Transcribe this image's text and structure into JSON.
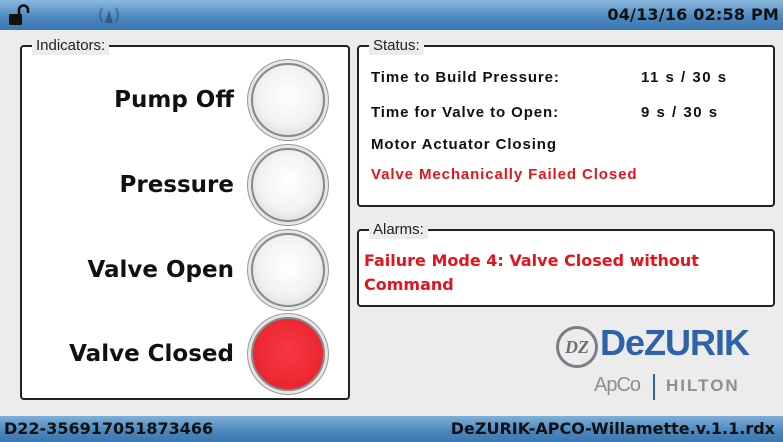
{
  "header": {
    "datetime": "04/13/16 02:58 PM",
    "lock_icon": "unlocked-padlock-icon",
    "signal_icon": "wireless-signal-icon"
  },
  "indicators": {
    "title": "Indicators:",
    "items": [
      {
        "label": "Pump Off",
        "state": "off",
        "color": "#f0f0f0"
      },
      {
        "label": "Pressure",
        "state": "off",
        "color": "#f0f0f0"
      },
      {
        "label": "Valve Open",
        "state": "off",
        "color": "#f0f0f0"
      },
      {
        "label": "Valve Closed",
        "state": "on",
        "color": "#ec2530"
      }
    ]
  },
  "status": {
    "title": "Status:",
    "lines": [
      {
        "label": "Time to Build Pressure:",
        "value": "11 s /  30 s"
      },
      {
        "label": "Time for Valve to Open:",
        "value": "9 s  /  30 s"
      },
      {
        "label": "Motor Actuator Closing"
      },
      {
        "label": "Valve Mechanically Failed Closed",
        "color": "#e4141b"
      }
    ]
  },
  "alarms": {
    "title": "Alarms:",
    "message": "Failure Mode 4: Valve Closed without Command",
    "color": "#e4141b"
  },
  "logo": {
    "mark": "DZ",
    "name": "DeZURIK",
    "sub1": "ApCo",
    "sub2": "HILTON",
    "brand_color": "#2d63a8"
  },
  "footer": {
    "serial": "D22-356917051873466",
    "filename": "DeZURIK-APCO-Willamette.v.1.1.rdx"
  }
}
